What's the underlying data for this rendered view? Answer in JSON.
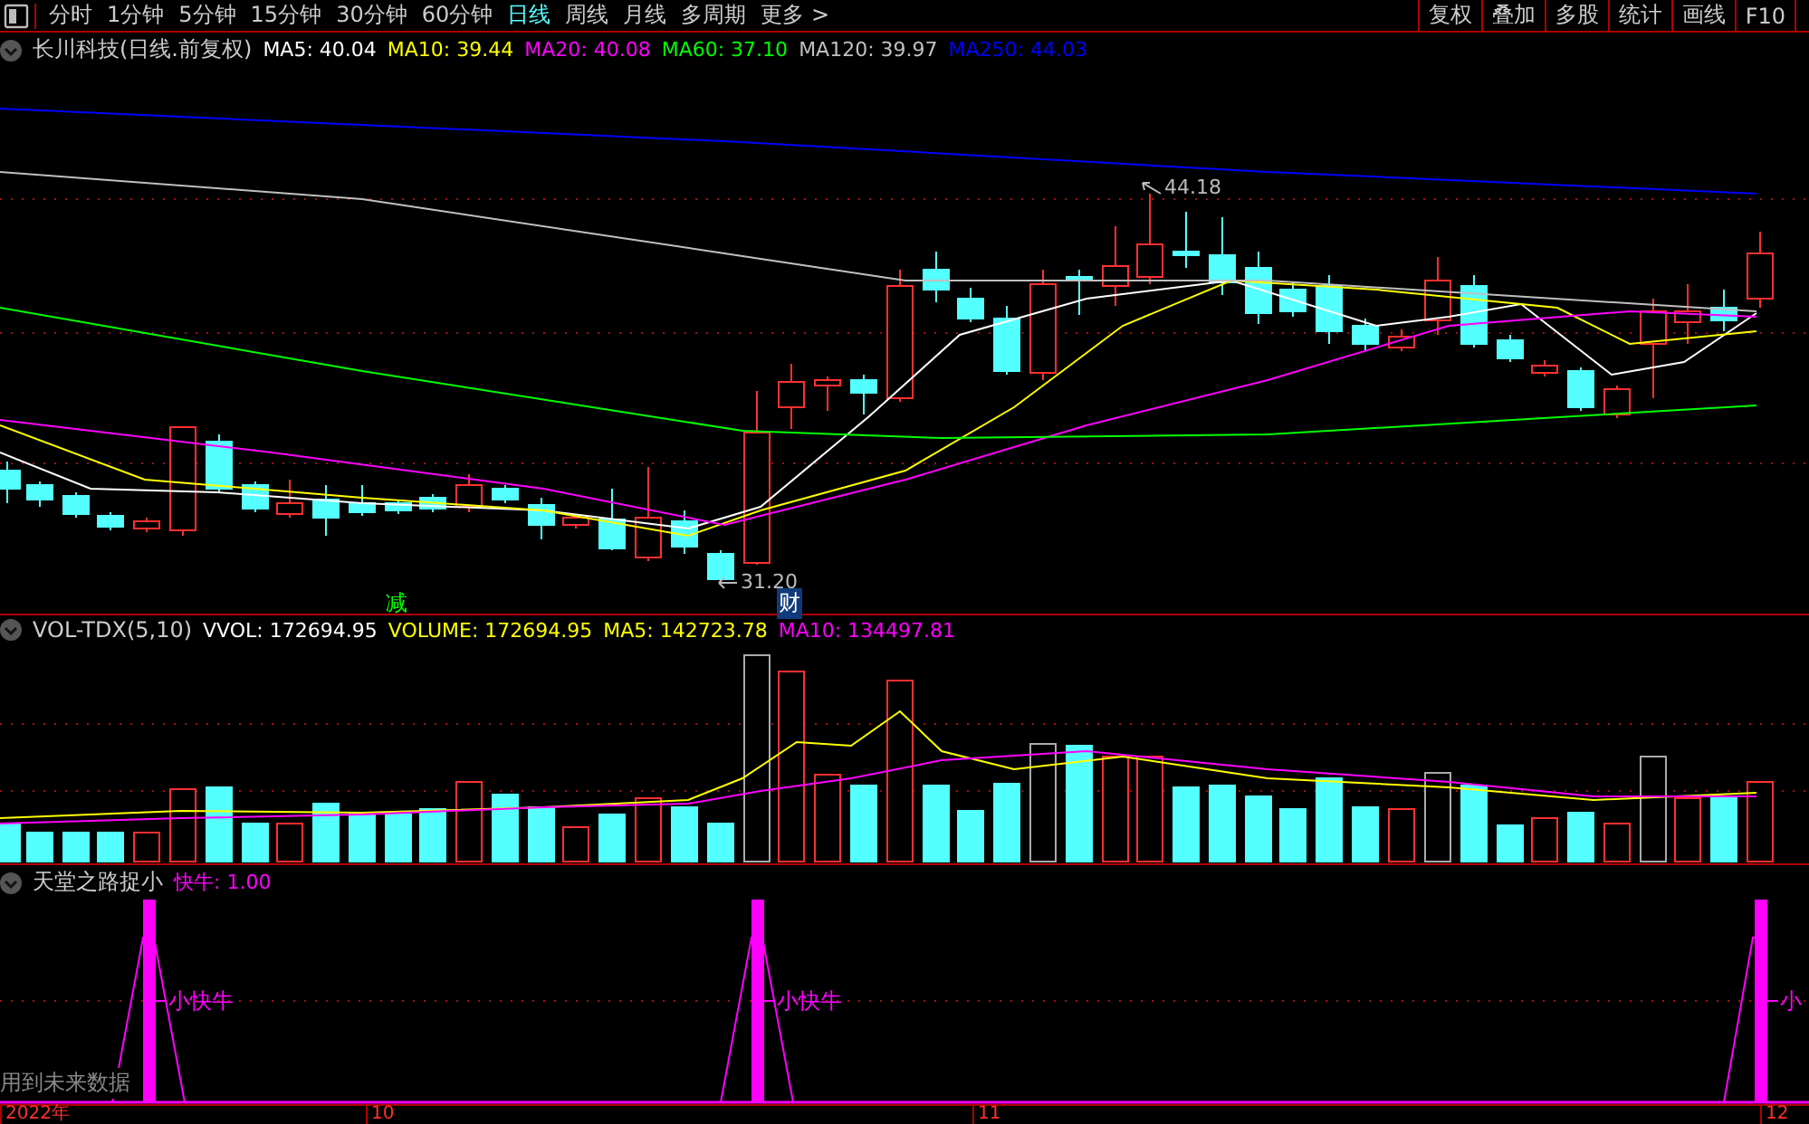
{
  "toolbar": {
    "periods": [
      {
        "label": "分时",
        "selected": false
      },
      {
        "label": "1分钟",
        "selected": false
      },
      {
        "label": "5分钟",
        "selected": false
      },
      {
        "label": "15分钟",
        "selected": false
      },
      {
        "label": "30分钟",
        "selected": false
      },
      {
        "label": "60分钟",
        "selected": false
      },
      {
        "label": "日线",
        "selected": true
      },
      {
        "label": "周线",
        "selected": false
      },
      {
        "label": "月线",
        "selected": false
      },
      {
        "label": "多周期",
        "selected": false
      },
      {
        "label": "更多 >",
        "selected": false
      }
    ],
    "actions": [
      "复权",
      "叠加",
      "多股",
      "统计",
      "画线",
      "F10"
    ]
  },
  "price_panel": {
    "title": "长川科技(日线.前复权)",
    "indicators": [
      {
        "label": "MA5: 40.04",
        "color": "#ffffff"
      },
      {
        "label": "MA10: 39.44",
        "color": "#ffff00"
      },
      {
        "label": "MA20: 40.08",
        "color": "#ff00ff"
      },
      {
        "label": "MA60: 37.10",
        "color": "#00ff00"
      },
      {
        "label": "MA120: 39.97",
        "color": "#c0c0c0"
      },
      {
        "label": "MA250: 44.03",
        "color": "#0000ff"
      }
    ],
    "marks": [
      {
        "text": "44.18",
        "kind": "high"
      },
      {
        "text": "31.20",
        "kind": "low"
      },
      {
        "text": "减",
        "kind": "event"
      },
      {
        "text": "财",
        "kind": "finance"
      }
    ]
  },
  "volume_panel": {
    "title": "VOL-TDX(5,10)",
    "indicators": [
      {
        "label": "VVOL: 172694.95",
        "color": "#ffffff"
      },
      {
        "label": "VOLUME: 172694.95",
        "color": "#ffff00"
      },
      {
        "label": "MA5: 142723.78",
        "color": "#ffff00"
      },
      {
        "label": "MA10: 134497.81",
        "color": "#ff00ff"
      }
    ]
  },
  "signal_panel": {
    "title": "天堂之路捉小",
    "indicators": [
      {
        "label": "快牛: 1.00",
        "color": "#ff00ff"
      }
    ],
    "signal_labels": [
      "小快牛",
      "小快牛",
      "小"
    ],
    "note": "用到未来数据"
  },
  "date_axis": [
    "2022年",
    "10",
    "11",
    "12"
  ]
}
